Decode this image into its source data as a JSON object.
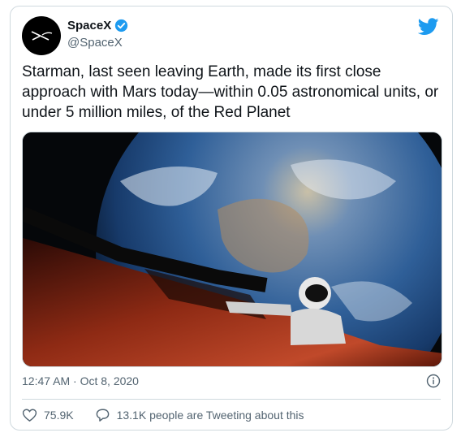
{
  "author": {
    "name": "SpaceX",
    "handle": "@SpaceX"
  },
  "tweet": {
    "text": "Starman, last seen leaving Earth, made its first close approach with Mars today—within 0.05 astronomical units, or under 5 million miles, of the Red Planet",
    "timestamp": "12:47 AM · Oct 8, 2020"
  },
  "stats": {
    "likes": "75.9K",
    "tweeting": "13.1K people are Tweeting about this"
  },
  "colors": {
    "twitter_blue": "#1d9bf0",
    "muted_text": "#536471",
    "border": "#cfd9de"
  },
  "icons": [
    "spacex-logo-icon",
    "verified-badge-icon",
    "twitter-bird-icon",
    "info-icon",
    "heart-icon",
    "comment-icon"
  ]
}
